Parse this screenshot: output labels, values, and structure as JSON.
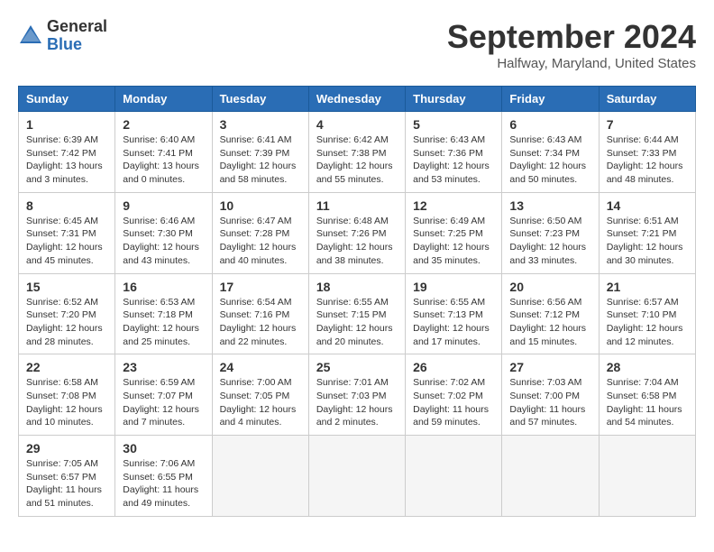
{
  "header": {
    "logo_general": "General",
    "logo_blue": "Blue",
    "month_title": "September 2024",
    "location": "Halfway, Maryland, United States"
  },
  "weekdays": [
    "Sunday",
    "Monday",
    "Tuesday",
    "Wednesday",
    "Thursday",
    "Friday",
    "Saturday"
  ],
  "weeks": [
    [
      {
        "day": "1",
        "info": "Sunrise: 6:39 AM\nSunset: 7:42 PM\nDaylight: 13 hours\nand 3 minutes."
      },
      {
        "day": "2",
        "info": "Sunrise: 6:40 AM\nSunset: 7:41 PM\nDaylight: 13 hours\nand 0 minutes."
      },
      {
        "day": "3",
        "info": "Sunrise: 6:41 AM\nSunset: 7:39 PM\nDaylight: 12 hours\nand 58 minutes."
      },
      {
        "day": "4",
        "info": "Sunrise: 6:42 AM\nSunset: 7:38 PM\nDaylight: 12 hours\nand 55 minutes."
      },
      {
        "day": "5",
        "info": "Sunrise: 6:43 AM\nSunset: 7:36 PM\nDaylight: 12 hours\nand 53 minutes."
      },
      {
        "day": "6",
        "info": "Sunrise: 6:43 AM\nSunset: 7:34 PM\nDaylight: 12 hours\nand 50 minutes."
      },
      {
        "day": "7",
        "info": "Sunrise: 6:44 AM\nSunset: 7:33 PM\nDaylight: 12 hours\nand 48 minutes."
      }
    ],
    [
      {
        "day": "8",
        "info": "Sunrise: 6:45 AM\nSunset: 7:31 PM\nDaylight: 12 hours\nand 45 minutes."
      },
      {
        "day": "9",
        "info": "Sunrise: 6:46 AM\nSunset: 7:30 PM\nDaylight: 12 hours\nand 43 minutes."
      },
      {
        "day": "10",
        "info": "Sunrise: 6:47 AM\nSunset: 7:28 PM\nDaylight: 12 hours\nand 40 minutes."
      },
      {
        "day": "11",
        "info": "Sunrise: 6:48 AM\nSunset: 7:26 PM\nDaylight: 12 hours\nand 38 minutes."
      },
      {
        "day": "12",
        "info": "Sunrise: 6:49 AM\nSunset: 7:25 PM\nDaylight: 12 hours\nand 35 minutes."
      },
      {
        "day": "13",
        "info": "Sunrise: 6:50 AM\nSunset: 7:23 PM\nDaylight: 12 hours\nand 33 minutes."
      },
      {
        "day": "14",
        "info": "Sunrise: 6:51 AM\nSunset: 7:21 PM\nDaylight: 12 hours\nand 30 minutes."
      }
    ],
    [
      {
        "day": "15",
        "info": "Sunrise: 6:52 AM\nSunset: 7:20 PM\nDaylight: 12 hours\nand 28 minutes."
      },
      {
        "day": "16",
        "info": "Sunrise: 6:53 AM\nSunset: 7:18 PM\nDaylight: 12 hours\nand 25 minutes."
      },
      {
        "day": "17",
        "info": "Sunrise: 6:54 AM\nSunset: 7:16 PM\nDaylight: 12 hours\nand 22 minutes."
      },
      {
        "day": "18",
        "info": "Sunrise: 6:55 AM\nSunset: 7:15 PM\nDaylight: 12 hours\nand 20 minutes."
      },
      {
        "day": "19",
        "info": "Sunrise: 6:55 AM\nSunset: 7:13 PM\nDaylight: 12 hours\nand 17 minutes."
      },
      {
        "day": "20",
        "info": "Sunrise: 6:56 AM\nSunset: 7:12 PM\nDaylight: 12 hours\nand 15 minutes."
      },
      {
        "day": "21",
        "info": "Sunrise: 6:57 AM\nSunset: 7:10 PM\nDaylight: 12 hours\nand 12 minutes."
      }
    ],
    [
      {
        "day": "22",
        "info": "Sunrise: 6:58 AM\nSunset: 7:08 PM\nDaylight: 12 hours\nand 10 minutes."
      },
      {
        "day": "23",
        "info": "Sunrise: 6:59 AM\nSunset: 7:07 PM\nDaylight: 12 hours\nand 7 minutes."
      },
      {
        "day": "24",
        "info": "Sunrise: 7:00 AM\nSunset: 7:05 PM\nDaylight: 12 hours\nand 4 minutes."
      },
      {
        "day": "25",
        "info": "Sunrise: 7:01 AM\nSunset: 7:03 PM\nDaylight: 12 hours\nand 2 minutes."
      },
      {
        "day": "26",
        "info": "Sunrise: 7:02 AM\nSunset: 7:02 PM\nDaylight: 11 hours\nand 59 minutes."
      },
      {
        "day": "27",
        "info": "Sunrise: 7:03 AM\nSunset: 7:00 PM\nDaylight: 11 hours\nand 57 minutes."
      },
      {
        "day": "28",
        "info": "Sunrise: 7:04 AM\nSunset: 6:58 PM\nDaylight: 11 hours\nand 54 minutes."
      }
    ],
    [
      {
        "day": "29",
        "info": "Sunrise: 7:05 AM\nSunset: 6:57 PM\nDaylight: 11 hours\nand 51 minutes."
      },
      {
        "day": "30",
        "info": "Sunrise: 7:06 AM\nSunset: 6:55 PM\nDaylight: 11 hours\nand 49 minutes."
      },
      {
        "day": "",
        "info": ""
      },
      {
        "day": "",
        "info": ""
      },
      {
        "day": "",
        "info": ""
      },
      {
        "day": "",
        "info": ""
      },
      {
        "day": "",
        "info": ""
      }
    ]
  ]
}
